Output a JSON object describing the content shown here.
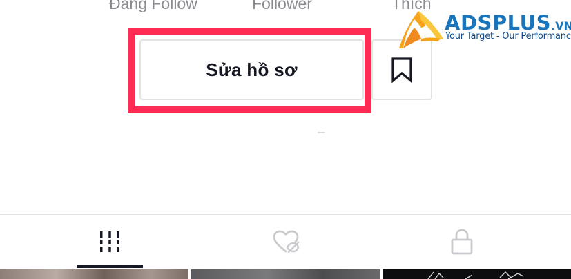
{
  "profile_stats": {
    "following_label": "Đang Follow",
    "followers_label": "Follower",
    "likes_label": "Thích"
  },
  "actions": {
    "edit_profile_label": "Sửa hồ sơ"
  },
  "watermark": {
    "brand_name": "ADSPLUS",
    "brand_tld": ".VN",
    "slogan": "Your Target - Our Performance"
  },
  "tabs": [
    {
      "id": "videos",
      "icon": "grid-icon",
      "active": true
    },
    {
      "id": "liked",
      "icon": "heart-hidden-icon",
      "active": false
    },
    {
      "id": "private",
      "icon": "lock-icon",
      "active": false
    }
  ],
  "colors": {
    "highlight": "#fe2c55",
    "text_primary": "#161823",
    "text_secondary": "#8a8b91",
    "border": "#e3e3e4",
    "icon_inactive": "#c9cacd",
    "brand_blue": "#1a75bb",
    "brand_orange": "#f7a21b"
  }
}
